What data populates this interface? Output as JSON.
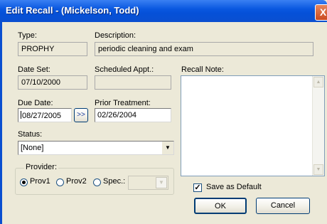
{
  "window": {
    "title": "Edit Recall - (Mickelson, Todd)",
    "close_glyph": "X"
  },
  "type": {
    "label": "Type:",
    "value": "PROPHY"
  },
  "description": {
    "label": "Description:",
    "value": "periodic cleaning and exam"
  },
  "date_set": {
    "label": "Date Set:",
    "value": "07/10/2000"
  },
  "scheduled_appt": {
    "label": "Scheduled Appt.:",
    "value": ""
  },
  "recall_note": {
    "label": "Recall Note:",
    "value": ""
  },
  "due_date": {
    "label": "Due Date:",
    "value": "08/27/2005",
    "advance_label": ">>"
  },
  "prior_treatment": {
    "label": "Prior Treatment:",
    "value": "02/26/2004"
  },
  "status": {
    "label": "Status:",
    "selected": "[None]"
  },
  "provider": {
    "label": "Provider:",
    "options": [
      "Prov1",
      "Prov2",
      "Spec.:"
    ],
    "selected": "Prov1"
  },
  "save_as_default": {
    "label": "Save as Default",
    "checked": true,
    "check_glyph": "✓"
  },
  "buttons": {
    "ok": "OK",
    "cancel": "Cancel"
  },
  "icons": {
    "dropdown": "▼",
    "scroll_up": "▲",
    "scroll_down": "▼"
  }
}
